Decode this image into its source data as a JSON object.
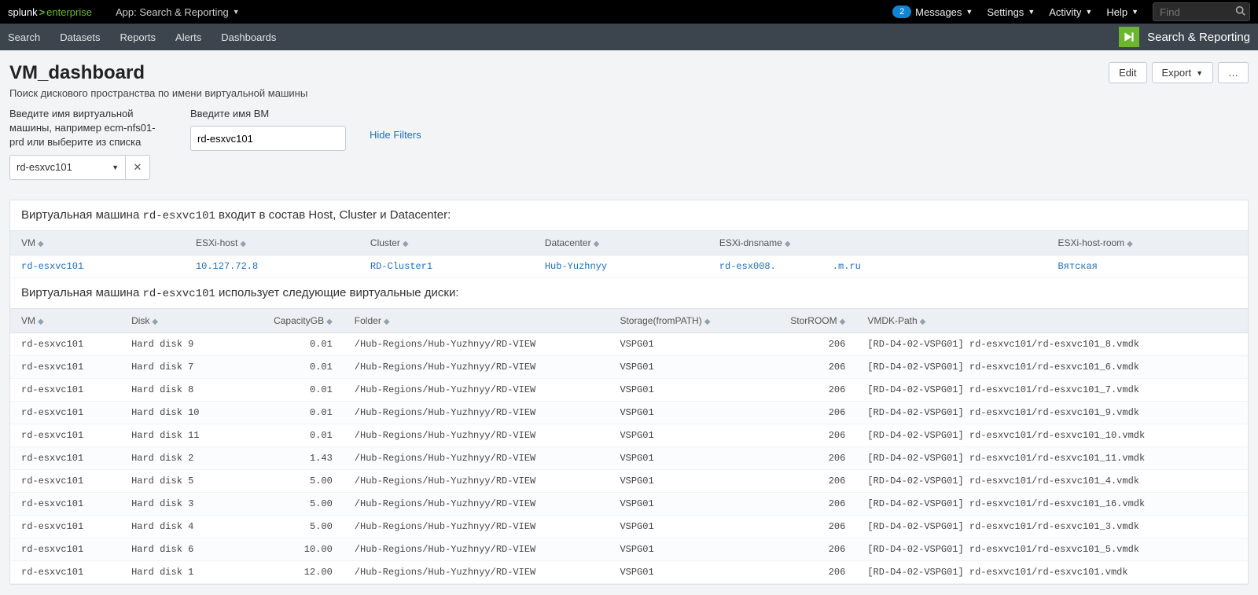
{
  "topbar": {
    "brand": {
      "pre": "splunk",
      "sep": ">",
      "post": "enterprise"
    },
    "app_label": "App: Search & Reporting",
    "messages_count": "2",
    "messages": "Messages",
    "settings": "Settings",
    "activity": "Activity",
    "help": "Help",
    "find_placeholder": "Find"
  },
  "navbar": {
    "items": [
      "Search",
      "Datasets",
      "Reports",
      "Alerts",
      "Dashboards"
    ],
    "right_label": "Search & Reporting"
  },
  "page": {
    "title": "VM_dashboard",
    "subtitle": "Поиск дискового пространства по имени виртуальной машины",
    "edit": "Edit",
    "export": "Export",
    "more": "…"
  },
  "inputs": {
    "select_label": "Введите имя виртуальной машины, например ecm-nfs01-prd или выберите из списка",
    "select_value": "rd-esxvc101",
    "text_label": "Введите имя ВМ",
    "text_value": "rd-esxvc101",
    "hide_filters": "Hide Filters"
  },
  "panel1": {
    "title_pre": "Виртуальная машина ",
    "title_mono": "rd-esxvc101",
    "title_post": " входит в состав Host, Cluster и Datacenter:",
    "columns": [
      "VM",
      "ESXi-host",
      "Cluster",
      "Datacenter",
      "ESXi-dnsname",
      "ESXi-host-room"
    ],
    "row": {
      "vm": "rd-esxvc101",
      "host": "10.127.72.8",
      "cluster": "RD-Cluster1",
      "datacenter": "Hub-Yuzhnyy",
      "dnsname": "rd-esx008.          .m.ru",
      "room": "Вятская"
    }
  },
  "panel2": {
    "title_pre": "Виртуальная машина ",
    "title_mono": "rd-esxvc101",
    "title_post": " использует следующие виртуальные диски:",
    "columns": [
      "VM",
      "Disk",
      "CapacityGB",
      "Folder",
      "Storage(fromPATH)",
      "StorROOM",
      "VMDK-Path"
    ],
    "rows": [
      {
        "vm": "rd-esxvc101",
        "disk": "Hard disk 9",
        "cap": "0.01",
        "folder": "/Hub-Regions/Hub-Yuzhnyy/RD-VIEW",
        "storage": "VSPG01",
        "room": "206",
        "path": "[RD-D4-02-VSPG01] rd-esxvc101/rd-esxvc101_8.vmdk"
      },
      {
        "vm": "rd-esxvc101",
        "disk": "Hard disk 7",
        "cap": "0.01",
        "folder": "/Hub-Regions/Hub-Yuzhnyy/RD-VIEW",
        "storage": "VSPG01",
        "room": "206",
        "path": "[RD-D4-02-VSPG01] rd-esxvc101/rd-esxvc101_6.vmdk"
      },
      {
        "vm": "rd-esxvc101",
        "disk": "Hard disk 8",
        "cap": "0.01",
        "folder": "/Hub-Regions/Hub-Yuzhnyy/RD-VIEW",
        "storage": "VSPG01",
        "room": "206",
        "path": "[RD-D4-02-VSPG01] rd-esxvc101/rd-esxvc101_7.vmdk"
      },
      {
        "vm": "rd-esxvc101",
        "disk": "Hard disk 10",
        "cap": "0.01",
        "folder": "/Hub-Regions/Hub-Yuzhnyy/RD-VIEW",
        "storage": "VSPG01",
        "room": "206",
        "path": "[RD-D4-02-VSPG01] rd-esxvc101/rd-esxvc101_9.vmdk"
      },
      {
        "vm": "rd-esxvc101",
        "disk": "Hard disk 11",
        "cap": "0.01",
        "folder": "/Hub-Regions/Hub-Yuzhnyy/RD-VIEW",
        "storage": "VSPG01",
        "room": "206",
        "path": "[RD-D4-02-VSPG01] rd-esxvc101/rd-esxvc101_10.vmdk"
      },
      {
        "vm": "rd-esxvc101",
        "disk": "Hard disk 2",
        "cap": "1.43",
        "folder": "/Hub-Regions/Hub-Yuzhnyy/RD-VIEW",
        "storage": "VSPG01",
        "room": "206",
        "path": "[RD-D4-02-VSPG01] rd-esxvc101/rd-esxvc101_11.vmdk"
      },
      {
        "vm": "rd-esxvc101",
        "disk": "Hard disk 5",
        "cap": "5.00",
        "folder": "/Hub-Regions/Hub-Yuzhnyy/RD-VIEW",
        "storage": "VSPG01",
        "room": "206",
        "path": "[RD-D4-02-VSPG01] rd-esxvc101/rd-esxvc101_4.vmdk"
      },
      {
        "vm": "rd-esxvc101",
        "disk": "Hard disk 3",
        "cap": "5.00",
        "folder": "/Hub-Regions/Hub-Yuzhnyy/RD-VIEW",
        "storage": "VSPG01",
        "room": "206",
        "path": "[RD-D4-02-VSPG01] rd-esxvc101/rd-esxvc101_16.vmdk"
      },
      {
        "vm": "rd-esxvc101",
        "disk": "Hard disk 4",
        "cap": "5.00",
        "folder": "/Hub-Regions/Hub-Yuzhnyy/RD-VIEW",
        "storage": "VSPG01",
        "room": "206",
        "path": "[RD-D4-02-VSPG01] rd-esxvc101/rd-esxvc101_3.vmdk"
      },
      {
        "vm": "rd-esxvc101",
        "disk": "Hard disk 6",
        "cap": "10.00",
        "folder": "/Hub-Regions/Hub-Yuzhnyy/RD-VIEW",
        "storage": "VSPG01",
        "room": "206",
        "path": "[RD-D4-02-VSPG01] rd-esxvc101/rd-esxvc101_5.vmdk"
      },
      {
        "vm": "rd-esxvc101",
        "disk": "Hard disk 1",
        "cap": "12.00",
        "folder": "/Hub-Regions/Hub-Yuzhnyy/RD-VIEW",
        "storage": "VSPG01",
        "room": "206",
        "path": "[RD-D4-02-VSPG01] rd-esxvc101/rd-esxvc101.vmdk"
      }
    ]
  }
}
